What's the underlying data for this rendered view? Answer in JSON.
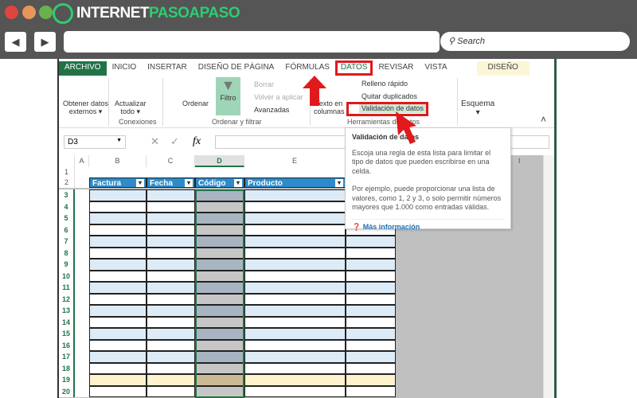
{
  "browser": {
    "logo_white": "INTERNET",
    "logo_green": "PASOAPASO",
    "back": "◀",
    "forward": "▶",
    "search_placeholder": "Search"
  },
  "ribbon": {
    "tabs": [
      "ARCHIVO",
      "INICIO",
      "INSERTAR",
      "DISEÑO DE PÁGINA",
      "FÓRMULAS",
      "DATOS",
      "REVISAR",
      "VISTA",
      "DISEÑO"
    ],
    "obtener": "Obtener datos",
    "externos": "externos ▾",
    "actualizar": "Actualizar",
    "todo": "todo ▾",
    "conexiones": "Conexiones",
    "ordenar": "Ordenar",
    "filtro": "Filtro",
    "borrar": "Borrar",
    "volver": "Volver a aplicar",
    "avanzadas": "Avanzadas",
    "ordenar_filtrar": "Ordenar y filtrar",
    "texto": "Texto en",
    "columnas": "columnas",
    "relleno": "Relleno rápido",
    "quitar": "Quitar duplicados",
    "validacion": "Validación de datos",
    "herramientas": "Herramientas de datos",
    "esquema": "Esquema",
    "esquema_arrow": "▾",
    "collapse": "˄"
  },
  "formula": {
    "name_box": "D3",
    "fx": "fx",
    "cancel": "✕",
    "enter": "✓"
  },
  "sheet": {
    "columns": [
      "A",
      "B",
      "C",
      "D",
      "E"
    ],
    "headers": [
      "Factura",
      "Fecha",
      "Código",
      "Producto"
    ],
    "rows": [
      "1",
      "2",
      "3",
      "4",
      "5",
      "6",
      "7",
      "8",
      "9",
      "10",
      "11",
      "12",
      "13",
      "14",
      "15",
      "16",
      "17",
      "18",
      "19",
      "20"
    ],
    "extra_col": "I"
  },
  "tooltip": {
    "title": "Validación de datos",
    "p1": "Escoja una regla de esta lista para limitar el tipo de datos que pueden escribirse en una celda.",
    "p2": "Por ejemplo, puede proporcionar una lista de valores, como 1, 2 y 3, o solo permitir números mayores que 1.000 como entradas válidas.",
    "link": "Más información"
  },
  "colors": {
    "accent": "#217346",
    "highlight": "#e0191c",
    "table_header": "#2e8bc9"
  }
}
